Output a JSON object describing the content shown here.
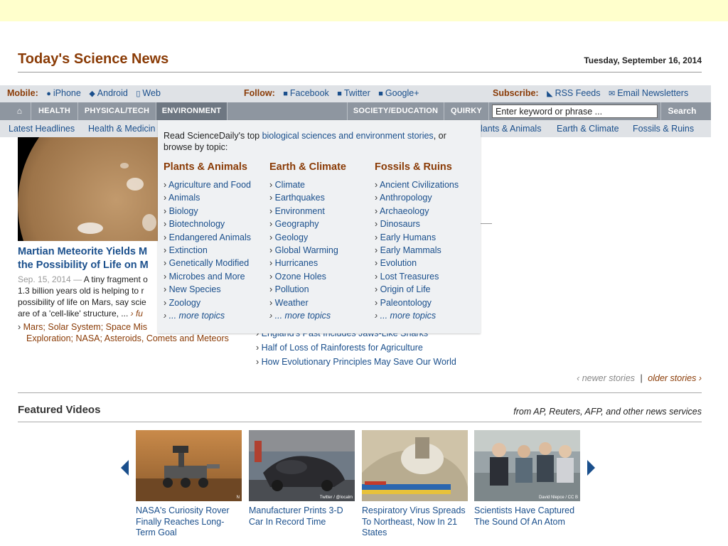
{
  "header": {
    "site_title": "Today's Science News",
    "date": "Tuesday, September 16, 2014"
  },
  "bar1": {
    "mobile_label": "Mobile:",
    "mobile_items": [
      "iPhone",
      "Android",
      "Web"
    ],
    "follow_label": "Follow:",
    "follow_items": [
      "Facebook",
      "Twitter",
      "Google+"
    ],
    "subscribe_label": "Subscribe:",
    "subscribe_items": [
      "RSS Feeds",
      "Email Newsletters"
    ]
  },
  "nav": {
    "home_icon": "home-icon",
    "items": [
      "Health",
      "Physical/Tech",
      "Environment",
      "Society/Education",
      "Quirky"
    ],
    "search_placeholder": "Enter keyword or phrase ...",
    "search_button": "Search"
  },
  "subnav": {
    "items": [
      "Latest Headlines",
      "Health & Medicin",
      "lants & Animals",
      "Earth & Climate",
      "Fossils & Ruins"
    ]
  },
  "dropdown": {
    "intro_pre": "Read ScienceDaily's top ",
    "intro_link": "biological sciences and environment stories",
    "intro_post": ", or browse by topic:",
    "columns": [
      {
        "heading": "Plants & Animals",
        "items": [
          "Agriculture and Food",
          "Animals",
          "Biology",
          "Biotechnology",
          "Endangered Animals",
          "Extinction",
          "Genetically Modified",
          "Microbes and More",
          "New Species",
          "Zoology"
        ],
        "more": "... more topics"
      },
      {
        "heading": "Earth & Climate",
        "items": [
          "Climate",
          "Earthquakes",
          "Environment",
          "Geography",
          "Geology",
          "Global Warming",
          "Hurricanes",
          "Ozone Holes",
          "Pollution",
          "Weather"
        ],
        "more": "... more topics"
      },
      {
        "heading": "Fossils & Ruins",
        "items": [
          "Ancient Civilizations",
          "Anthropology",
          "Archaeology",
          "Dinosaurs",
          "Early Humans",
          "Early Mammals",
          "Evolution",
          "Lost Treasures",
          "Origin of Life",
          "Paleontology"
        ],
        "more": "... more topics"
      }
    ]
  },
  "story": {
    "title_line1": "Martian Meteorite Yields M",
    "title_line2": "the Possibility of Life on M",
    "date": "Sep. 15, 2014 —",
    "body": " A tiny fragment o 1.3 billion years old is helping to r possibility of life on Mars, say scie are of a 'cell-like' structure, ... ",
    "more": "› fu",
    "tags_line1": "Mars; Solar System; Space Mis",
    "tags_line2": "Exploration; NASA; Asteroids, Comets and Meteors"
  },
  "right_links": [
    "England's Past Includes Jaws-Like Sharks",
    "Half of Loss of Rainforests for Agriculture",
    "How Evolutionary Principles May Save Our World"
  ],
  "pager": {
    "newer": "‹ newer stories",
    "sep": "|",
    "older": "older stories ›"
  },
  "featured": {
    "title": "Featured Videos",
    "note": "from AP, Reuters, AFP, and other news services",
    "videos": [
      {
        "caption": "NASA's Curiosity Rover Finally Reaches Long-Term Goal",
        "credit": "N"
      },
      {
        "caption": "Manufacturer Prints 3-D Car In Record Time",
        "credit": "Twitter / @localm"
      },
      {
        "caption": "Respiratory Virus Spreads To Northeast, Now In 21 States",
        "credit": ""
      },
      {
        "caption": "Scientists Have Captured The Sound Of An Atom",
        "credit": "David Nlepce / CC B"
      }
    ]
  }
}
